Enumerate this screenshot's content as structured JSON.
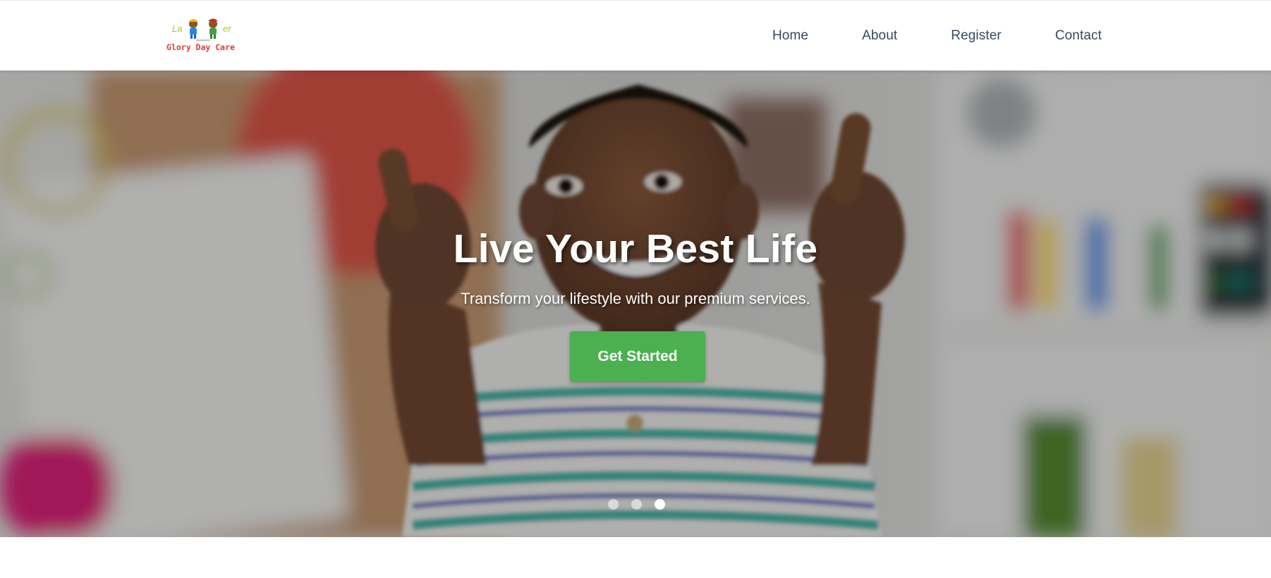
{
  "brand": {
    "logo_top_left": "La",
    "logo_top_right": "er",
    "logo_bottom": "Glory Day Care"
  },
  "nav": {
    "items": [
      {
        "label": "Home"
      },
      {
        "label": "About"
      },
      {
        "label": "Register"
      },
      {
        "label": "Contact"
      }
    ]
  },
  "hero": {
    "title": "Live Your Best Life",
    "subtitle": "Transform your lifestyle with our premium services.",
    "cta_label": "Get Started",
    "slide_count": 3,
    "active_slide": 3
  },
  "colors": {
    "cta": "#4caf50",
    "nav_text": "#34495e",
    "logo_green": "#9ccc14",
    "logo_red": "#e53935"
  }
}
